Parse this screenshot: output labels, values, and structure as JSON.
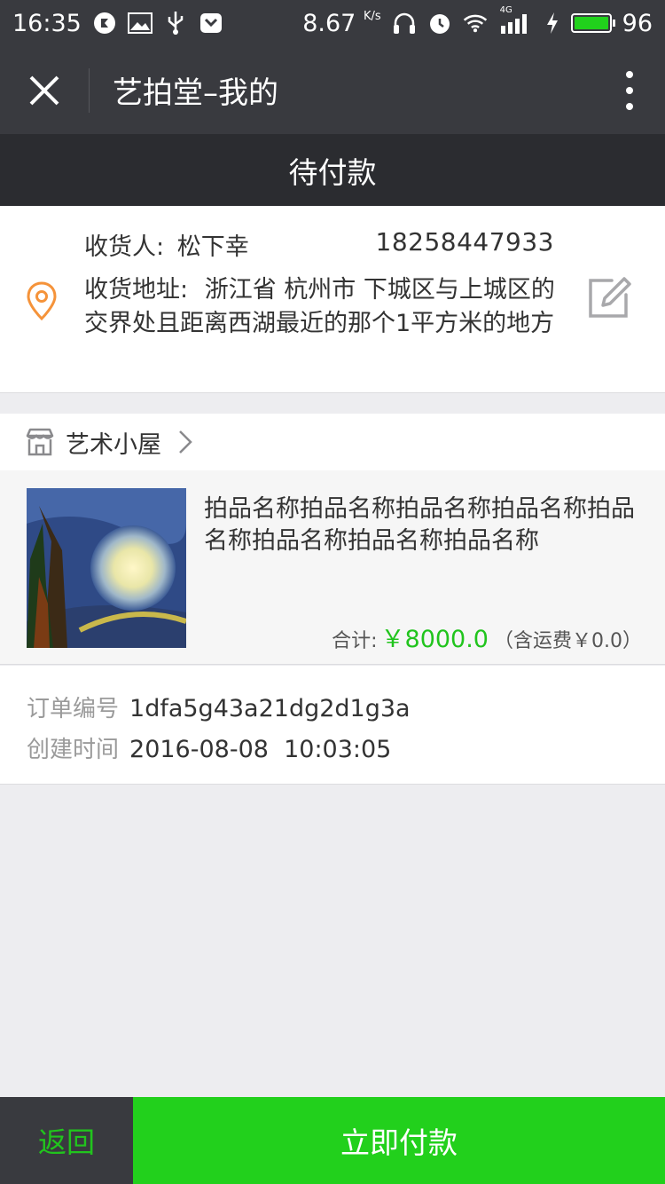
{
  "status_bar": {
    "time": "16:35",
    "speed": "8.67",
    "speed_unit": "K/s",
    "network": "4G",
    "battery": "96"
  },
  "title_bar": {
    "title": "艺拍堂–我的"
  },
  "order_status": "待付款",
  "address": {
    "receiver_label": "收货人:",
    "receiver_name": "松下幸",
    "phone": "18258447933",
    "address_label": "收货地址:",
    "address_text": "浙江省 杭州市 下城区与上城区的交界处且距离西湖最近的那个1平方米的地方"
  },
  "shop": {
    "name": "艺术小屋"
  },
  "product": {
    "name": "拍品名称拍品名称拍品名称拍品名称拍品名称拍品名称拍品名称拍品名称",
    "total_label": "合计:",
    "total_value": "￥8000.0",
    "shipping": "（含运费￥0.0）"
  },
  "order_info": {
    "number_label": "订单编号",
    "number_value": "1dfa5g43a21dg2d1g3a",
    "created_label": "创建时间",
    "created_value": "2016-08-08  10:03:05"
  },
  "actions": {
    "back": "返回",
    "pay": "立即付款"
  },
  "colors": {
    "accent_green": "#22d01c",
    "dark_bar": "#393a3f",
    "location_orange": "#f5933a"
  }
}
